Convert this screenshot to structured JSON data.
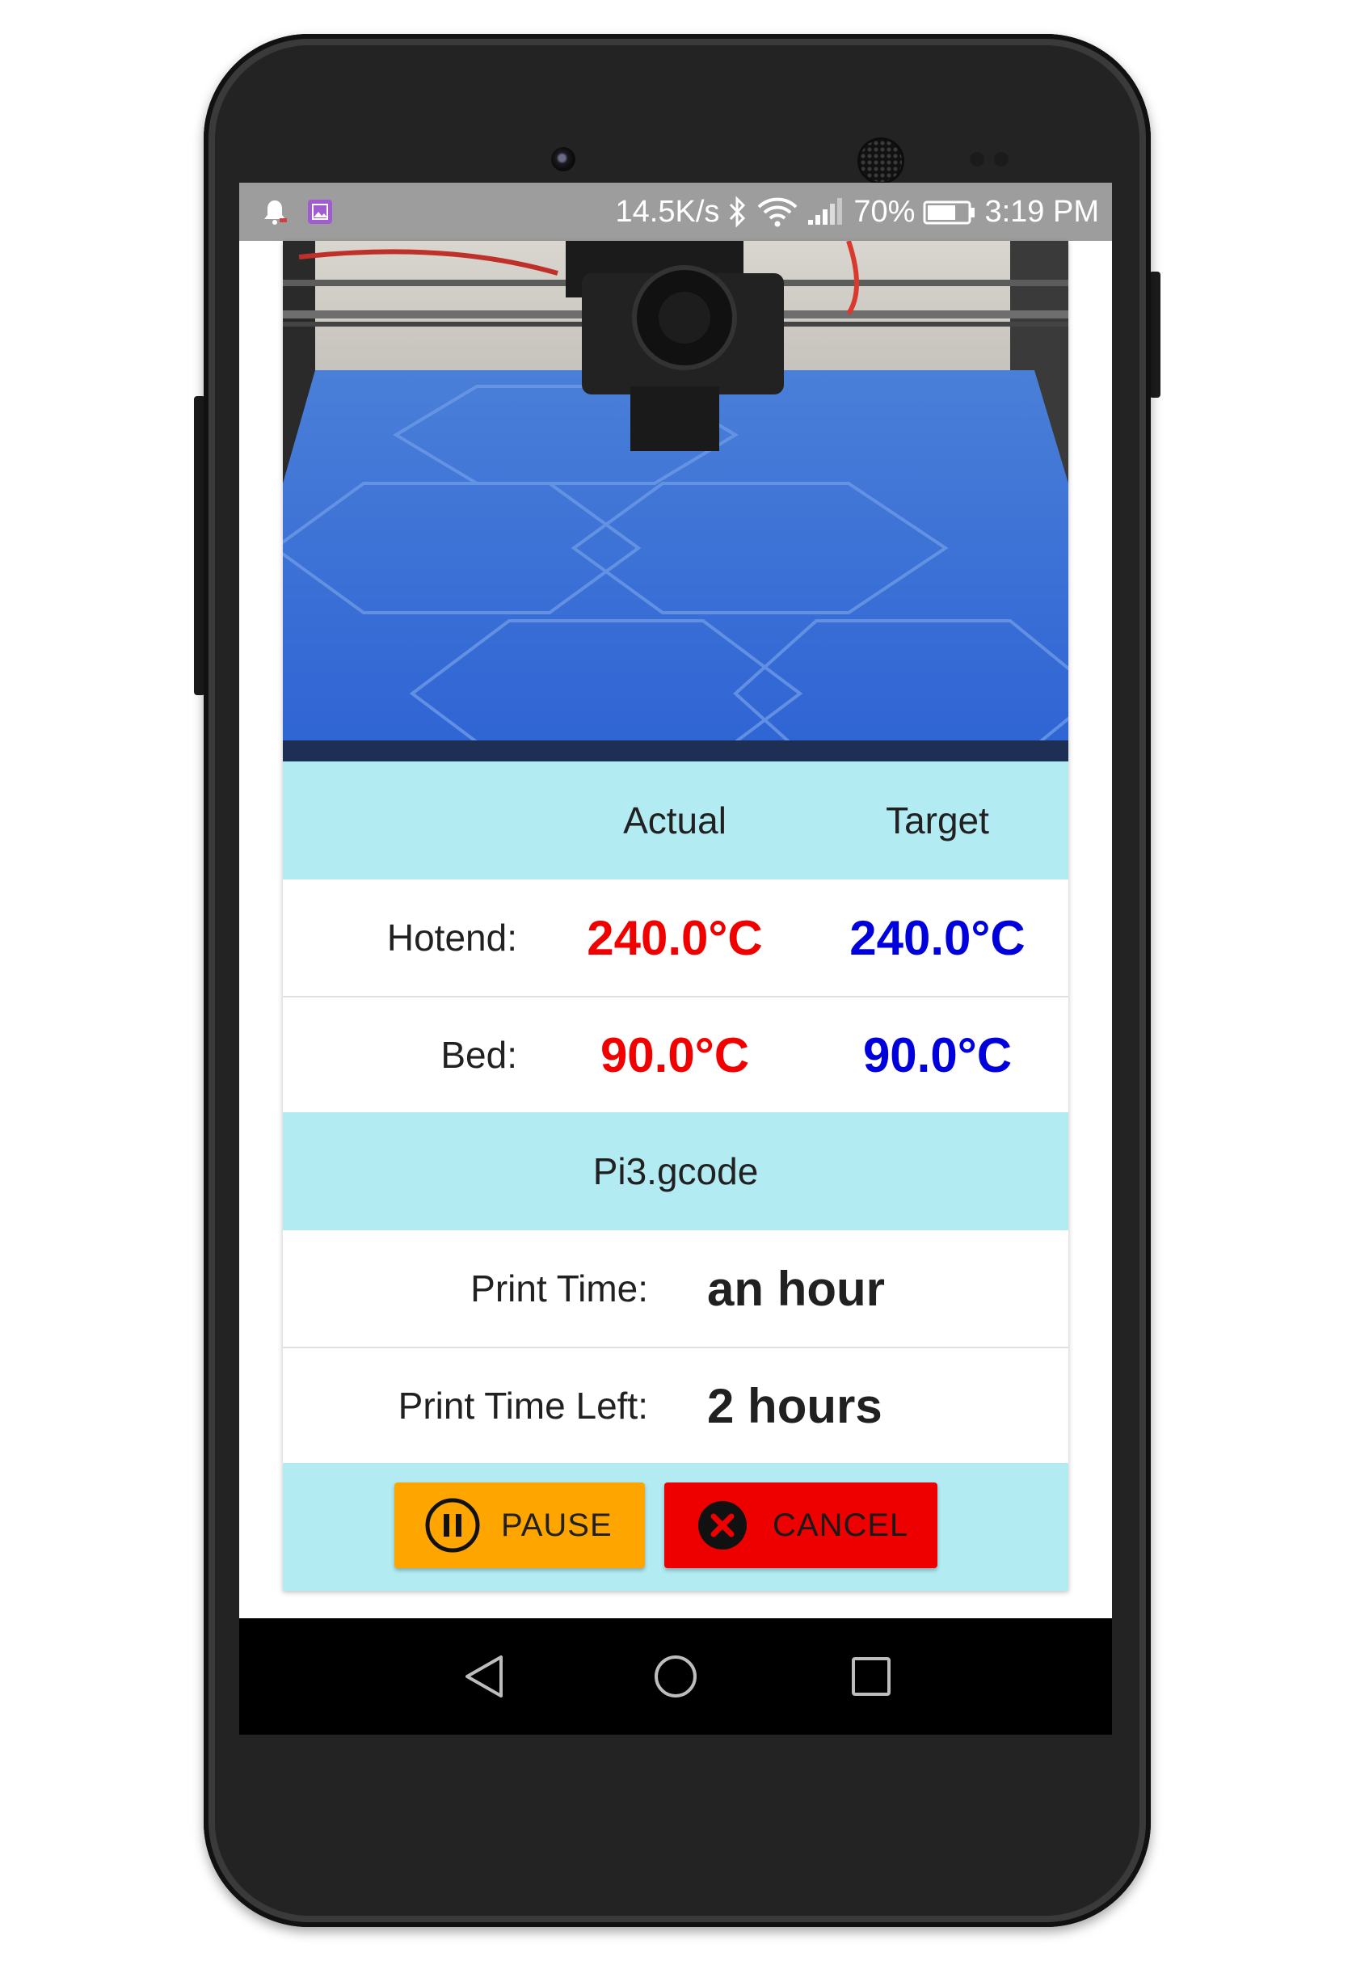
{
  "status_bar": {
    "net_speed": "14.5K/s",
    "battery": "70%",
    "time": "3:19 PM",
    "icons": [
      "bell-icon",
      "image-icon",
      "bluetooth-icon",
      "wifi-icon",
      "signal-icon",
      "battery-icon"
    ]
  },
  "webcam": {
    "alt": "printer-webcam-feed"
  },
  "temperature_table": {
    "header": {
      "actual": "Actual",
      "target": "Target"
    },
    "rows": [
      {
        "label": "Hotend:",
        "actual": "240.0°C",
        "target": "240.0°C"
      },
      {
        "label": "Bed:",
        "actual": "90.0°C",
        "target": "90.0°C"
      }
    ]
  },
  "job": {
    "file_name": "Pi3.gcode",
    "print_time_label": "Print Time:",
    "print_time_value": "an hour",
    "print_time_left_label": "Print Time Left:",
    "print_time_left_value": "2 hours"
  },
  "actions": {
    "pause_label": "PAUSE",
    "cancel_label": "CANCEL"
  },
  "colors": {
    "accent_cyan": "#b2ebf2",
    "actual_red": "#f20000",
    "target_blue": "#0000dd",
    "pause_orange": "#ffa500",
    "cancel_red": "#ee0000"
  },
  "nav_bar": {
    "icons": [
      "back-icon",
      "home-icon",
      "recents-icon"
    ]
  }
}
